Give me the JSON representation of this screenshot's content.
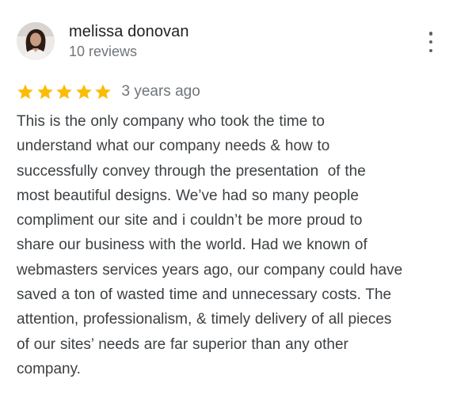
{
  "review": {
    "author_name": "melissa donovan",
    "review_count": "10 reviews",
    "rating": 5,
    "rating_max": 5,
    "star_color": "#fbbc04",
    "timestamp": "3 years ago",
    "text": "This is the only company who took the time to\nunderstand what our company needs & how to\nsuccessfully convey through the presentation  of the\nmost beautiful designs. We’ve had so many people\ncompliment our site and i couldn’t be more proud to\nshare our business with the world. Had we known of\nwebmasters services years ago, our company could have\nsaved a ton of wasted time and unnecessary costs. The\nattention, professionalism, & timely delivery of all pieces\nof our sites’ needs are far superior than any other\ncompany."
  },
  "icons": {
    "avatar": "profile-photo",
    "menu": "more-vert-icon",
    "star": "star-icon"
  }
}
